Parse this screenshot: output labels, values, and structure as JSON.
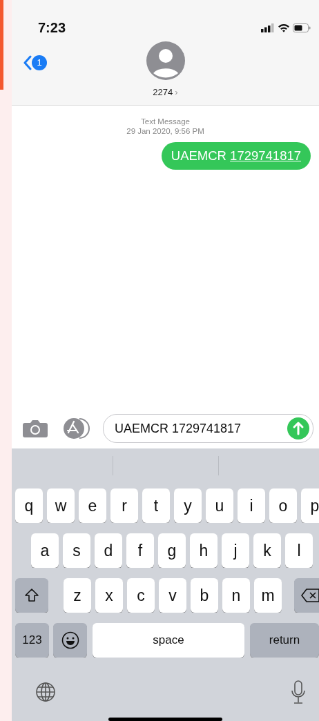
{
  "status_bar": {
    "time": "7:23"
  },
  "header": {
    "unread_count": "1",
    "contact": "2274",
    "chevron": "›"
  },
  "conversation": {
    "service": "Text Message",
    "timestamp": "29 Jan 2020, 9:56 PM",
    "messages": [
      {
        "kind": "sent",
        "parts": [
          {
            "text": "UAEMCR ",
            "link": false
          },
          {
            "text": "1729741817",
            "link": true
          }
        ]
      }
    ]
  },
  "composer": {
    "value": "UAEMCR 1729741817"
  },
  "keyboard": {
    "rows": [
      {
        "keys": [
          {
            "kind": "letter",
            "label": "q"
          },
          {
            "kind": "letter",
            "label": "w"
          },
          {
            "kind": "letter",
            "label": "e"
          },
          {
            "kind": "letter",
            "label": "r"
          },
          {
            "kind": "letter",
            "label": "t"
          },
          {
            "kind": "letter",
            "label": "y"
          },
          {
            "kind": "letter",
            "label": "u"
          },
          {
            "kind": "letter",
            "label": "i"
          },
          {
            "kind": "letter",
            "label": "o"
          },
          {
            "kind": "letter",
            "label": "p"
          }
        ]
      },
      {
        "keys": [
          {
            "kind": "letter",
            "label": "a"
          },
          {
            "kind": "letter",
            "label": "s"
          },
          {
            "kind": "letter",
            "label": "d"
          },
          {
            "kind": "letter",
            "label": "f"
          },
          {
            "kind": "letter",
            "label": "g"
          },
          {
            "kind": "letter",
            "label": "h"
          },
          {
            "kind": "letter",
            "label": "j"
          },
          {
            "kind": "letter",
            "label": "k"
          },
          {
            "kind": "letter",
            "label": "l"
          }
        ]
      },
      {
        "keys": [
          {
            "kind": "shift"
          },
          {
            "kind": "letter",
            "label": "z"
          },
          {
            "kind": "letter",
            "label": "x"
          },
          {
            "kind": "letter",
            "label": "c"
          },
          {
            "kind": "letter",
            "label": "v"
          },
          {
            "kind": "letter",
            "label": "b"
          },
          {
            "kind": "letter",
            "label": "n"
          },
          {
            "kind": "letter",
            "label": "m"
          },
          {
            "kind": "backspace"
          }
        ]
      },
      {
        "keys": [
          {
            "kind": "numbers",
            "label": "123"
          },
          {
            "kind": "emoji"
          },
          {
            "kind": "space",
            "label": "space"
          },
          {
            "kind": "return",
            "label": "return"
          }
        ]
      }
    ]
  }
}
